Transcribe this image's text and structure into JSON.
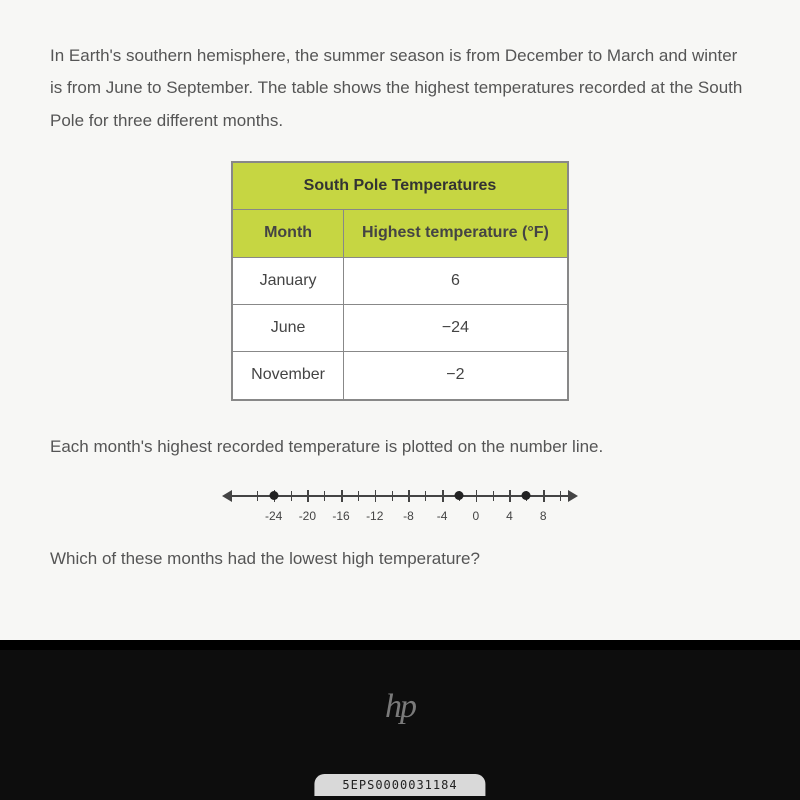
{
  "intro": "In Earth's southern hemisphere, the summer season is from December to March and winter is from June to September. The table shows the highest temperatures recorded at the South Pole for three different months.",
  "table": {
    "title": "South Pole Temperatures",
    "headers": {
      "month": "Month",
      "temp": "Highest temperature (°F)"
    },
    "rows": [
      {
        "month": "January",
        "temp": "6"
      },
      {
        "month": "June",
        "temp": "−24"
      },
      {
        "month": "November",
        "temp": "−2"
      }
    ]
  },
  "plot_text": "Each month's highest recorded temperature is plotted on the number line.",
  "question": "Which of these months had the lowest high temperature?",
  "chart_data": {
    "type": "number_line",
    "range": [
      -28,
      10
    ],
    "major_ticks": [
      -24,
      -20,
      -16,
      -12,
      -8,
      -4,
      0,
      4,
      8
    ],
    "points": [
      -24,
      -2,
      6
    ]
  },
  "laptop": {
    "brand": "hp",
    "asset_tag": "5EPS0000031184"
  }
}
